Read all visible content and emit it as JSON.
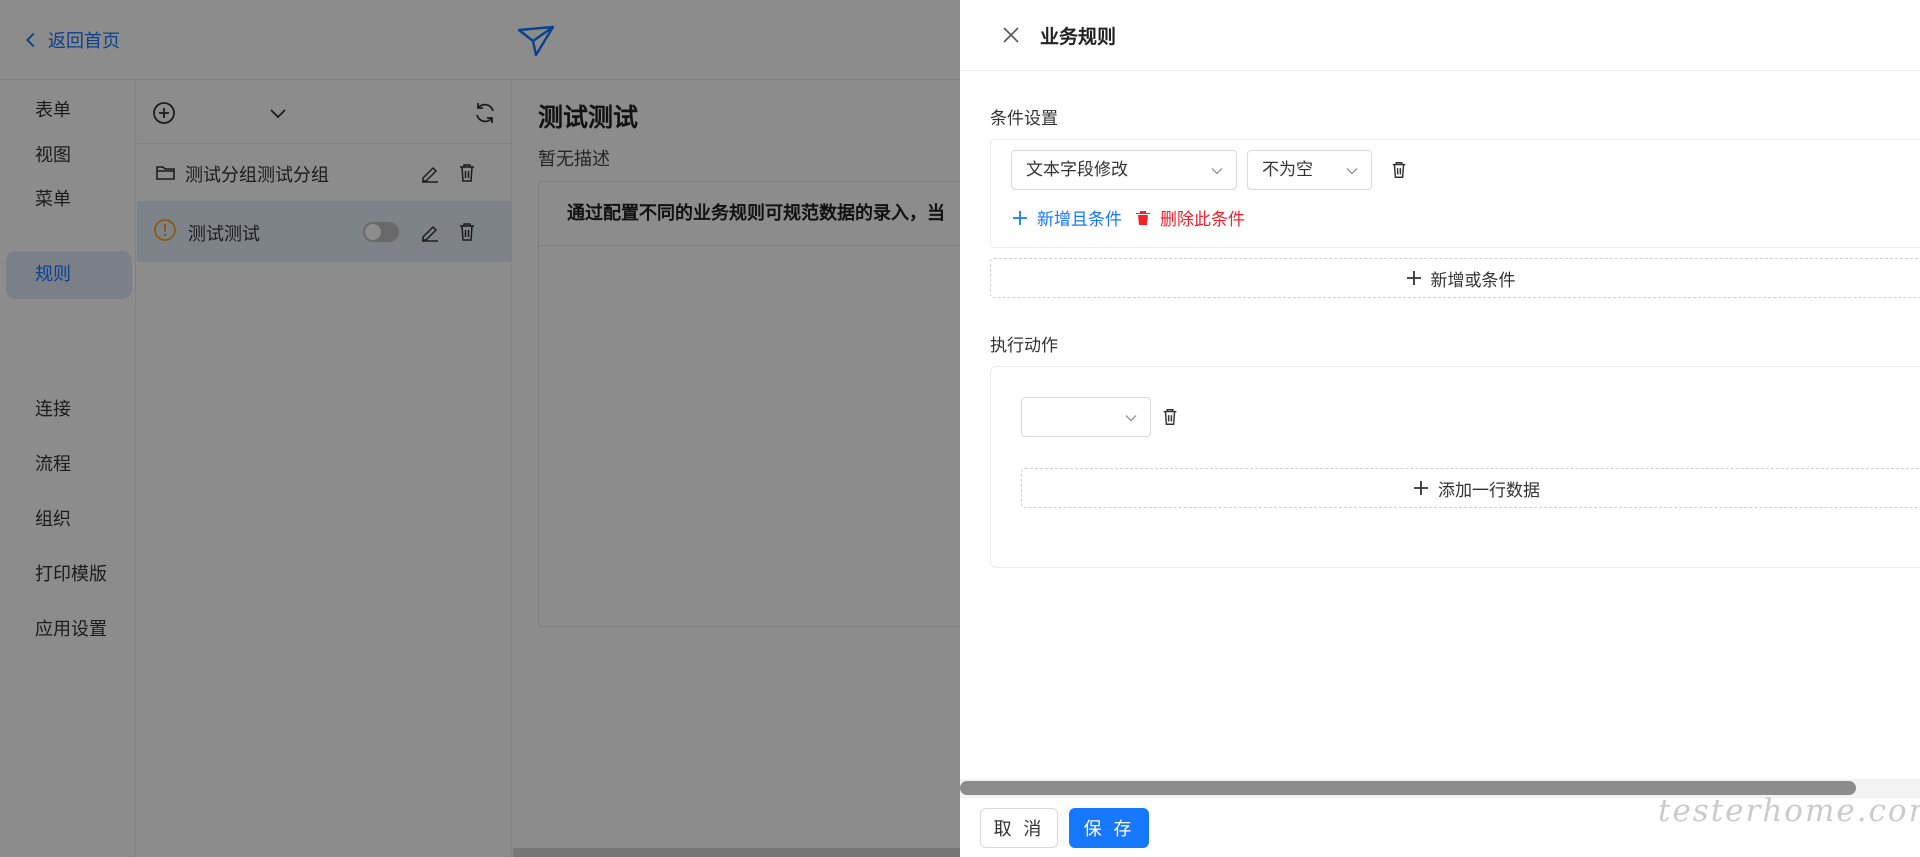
{
  "app": {
    "back_label": "返回首页",
    "logo_icon": "paper-plane-icon",
    "accent_color": "#1677ff"
  },
  "sidebar": {
    "items": [
      {
        "label": "表单"
      },
      {
        "label": "视图"
      },
      {
        "label": "菜单"
      },
      {
        "label": "规则",
        "active": true
      },
      {
        "label": "连接"
      },
      {
        "label": "流程"
      },
      {
        "label": "组织"
      },
      {
        "label": "打印模版"
      },
      {
        "label": "应用设置"
      }
    ]
  },
  "rule_list": {
    "toolbar_icons": [
      "add-circle-icon",
      "chevron-down-icon",
      "refresh-icon"
    ],
    "group": {
      "label": "测试分组测试分组",
      "icon": "folder-icon"
    },
    "rule": {
      "label": "测试测试",
      "icon": "warning-icon",
      "enabled": false
    }
  },
  "main": {
    "title": "测试测试",
    "description": "暂无描述",
    "card_text": "通过配置不同的业务规则可规范数据的录入，当"
  },
  "drawer": {
    "title": "业务规则",
    "condition_section": {
      "label": "条件设置",
      "field_select": "文本字段修改",
      "operator_select": "不为空",
      "add_and_label": "新增且条件",
      "delete_label": "删除此条件",
      "add_or_label": "新增或条件"
    },
    "action_section": {
      "label": "执行动作",
      "action_select": "",
      "add_row_label": "添加一行数据"
    },
    "footer": {
      "cancel_label": "取 消",
      "save_label": "保 存"
    }
  },
  "watermark": "testerhome.com"
}
